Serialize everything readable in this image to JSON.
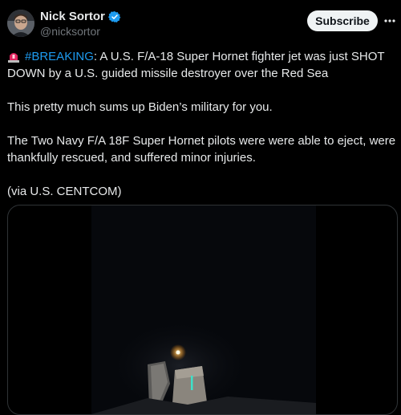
{
  "author": {
    "display_name": "Nick Sortor",
    "handle": "@nicksortor",
    "verified": true,
    "verified_color": "#1d9bf0"
  },
  "actions": {
    "subscribe_label": "Subscribe",
    "more_icon": "more-horizontal-icon"
  },
  "tweet": {
    "alert_icon": "siren-icon",
    "hashtag": "#BREAKING",
    "line1_rest": ": A U.S. F/A-18 Super Hornet fighter jet was just SHOT DOWN by a U.S. guided missile destroyer over the Red Sea",
    "line2": "This pretty much sums up Biden’s military for you.",
    "line3": "The Two Navy F/A 18F Super Hornet pilots were were able to eject, were thankfully rescued, and suffered minor injuries.",
    "line4": "(via U.S. CENTCOM)"
  },
  "colors": {
    "background": "#000000",
    "text": "#e7e9ea",
    "secondary_text": "#71767b",
    "hashtag": "#1d9bf0"
  }
}
